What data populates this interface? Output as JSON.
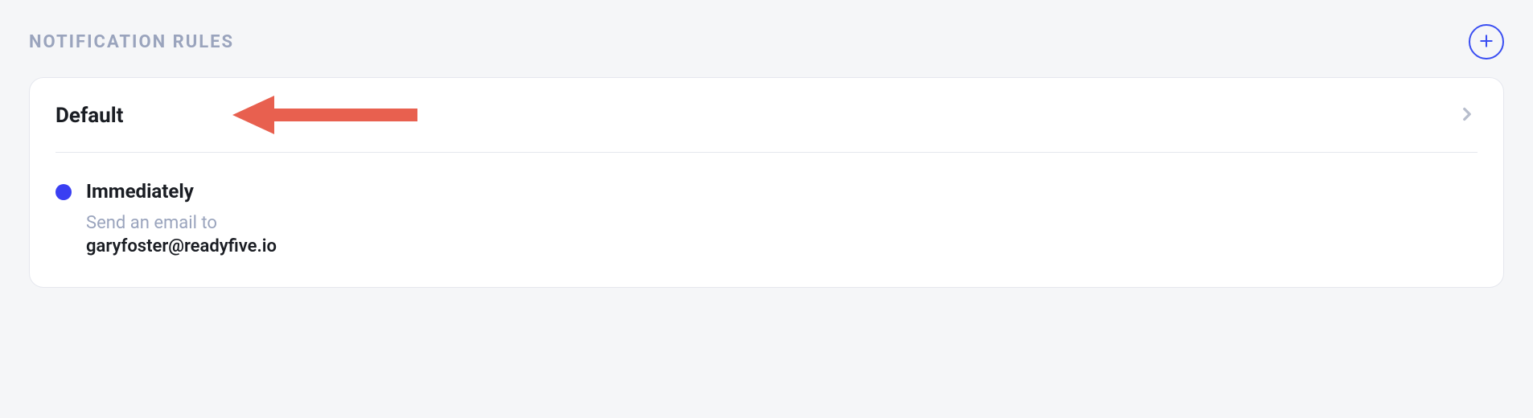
{
  "section_title": "NOTIFICATION RULES",
  "card": {
    "rule_name": "Default",
    "steps": [
      {
        "timing": "Immediately",
        "action_label": "Send an email to",
        "action_value": "garyfoster@readyfive.io"
      }
    ]
  },
  "colors": {
    "accent": "#3a4ef2",
    "muted_text": "#9aa4bd",
    "annotation_arrow": "#e8604f"
  }
}
